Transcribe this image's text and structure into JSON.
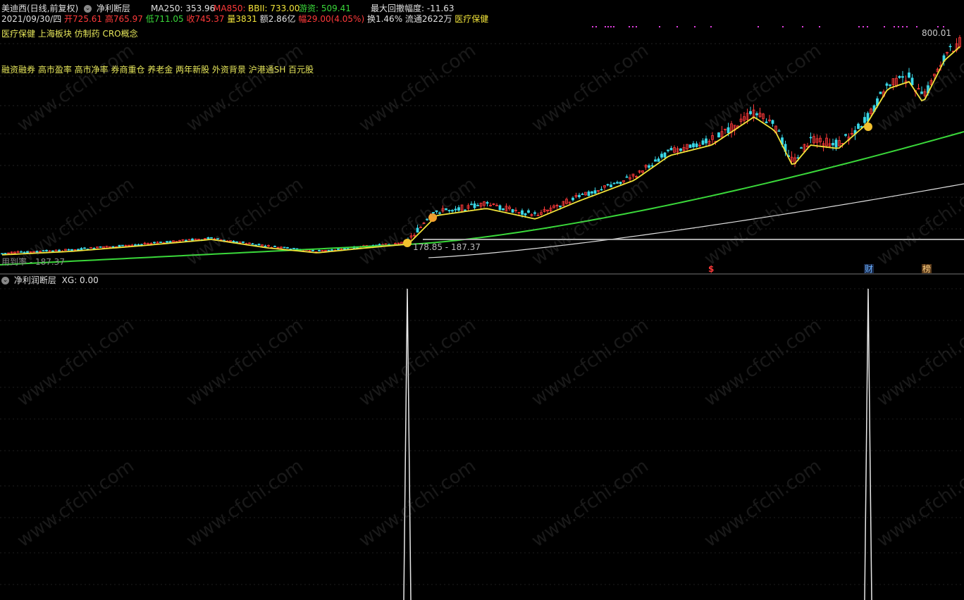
{
  "header": {
    "stock_title": "美迪西(日线,前复权)",
    "indicator_name": "净利断层",
    "ma250": "MA250: 353.96",
    "ma850": "MA850: -",
    "bbii": "BBII: 733.00",
    "youzi": "游资: 509.41",
    "max_drawdown": "最大回撤幅度: -11.63"
  },
  "quote": {
    "date": "2021/09/30/四",
    "open": "开725.61",
    "high": "高765.97",
    "low": "低711.05",
    "close": "收745.37",
    "volume": "量3831",
    "amount": "额2.86亿",
    "change": "幅29.00(4.05%)",
    "turnover": "换1.46%",
    "float": "流通2622万",
    "sector": "医疗保健"
  },
  "tags_line1": "医疗保健 上海板块 仿制药 CRO概念",
  "tags_line2": "融资融券 高市盈率 高市净率 券商重仓 养老金 两年新股 外资背景 沪港通SH 百元股",
  "price_labels": {
    "top_price": "800.01",
    "bottom_price": "187.37",
    "mid_label": "178.85 - 187.37",
    "left_label": "用到率 - 187.37"
  },
  "markers": {
    "dollar": "$",
    "finance": "财",
    "rank": "榜"
  },
  "subpanel": {
    "title": "净利润断层",
    "xg": "XG: 0.00"
  },
  "watermark": "www.cfchi.com",
  "colors": {
    "background": "#000000",
    "up_candle": "#ff3a3a",
    "down_candle": "#3ad8e8",
    "ma_yellow": "#f2e43a",
    "ma_green": "#3ad83a",
    "ma_white": "#e0e0e0",
    "label_magenta": "#e040e0"
  }
}
